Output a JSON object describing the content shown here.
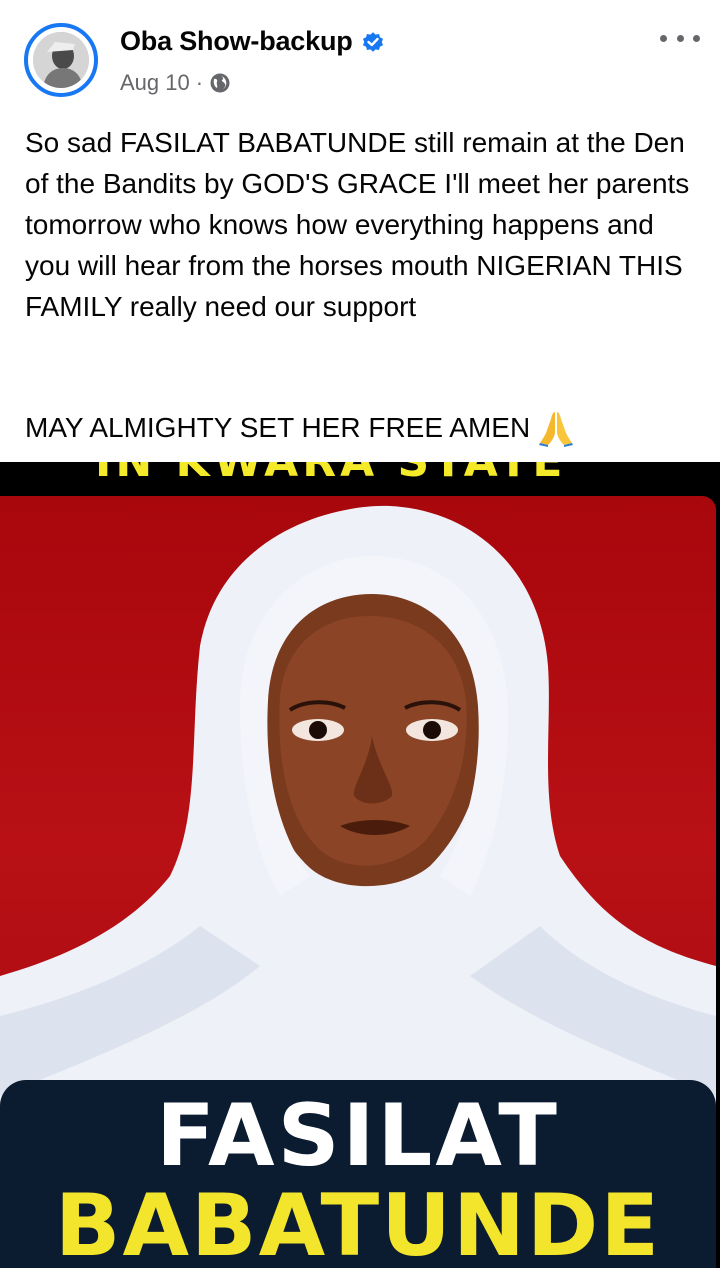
{
  "post": {
    "author_name": "Oba Show-backup",
    "date": "Aug 10",
    "separator": "·",
    "body_text": "So sad FASILAT BABATUNDE still remain at the Den of the Bandits by GOD'S GRACE I'll meet her parents tomorrow who knows how everything happens and you will hear from the horses mouth NIGERIAN THIS FAMILY really need our support",
    "closing_text": "MAY ALMIGHTY SET HER FREE AMEN",
    "closing_emoji": "folded-hands-emoji",
    "privacy_icon": "globe-icon",
    "verified_icon": "verified-badge-icon",
    "more_icon": "more-options-icon"
  },
  "photo": {
    "banner_text": "IN KWARA STATE",
    "first_name": "FASILAT",
    "last_name": "BABATUNDE"
  },
  "colors": {
    "accent": "#1877f2",
    "poster_red": "#b81015",
    "name_plate": "#0b1b30",
    "name_yellow": "#f3e52b"
  }
}
